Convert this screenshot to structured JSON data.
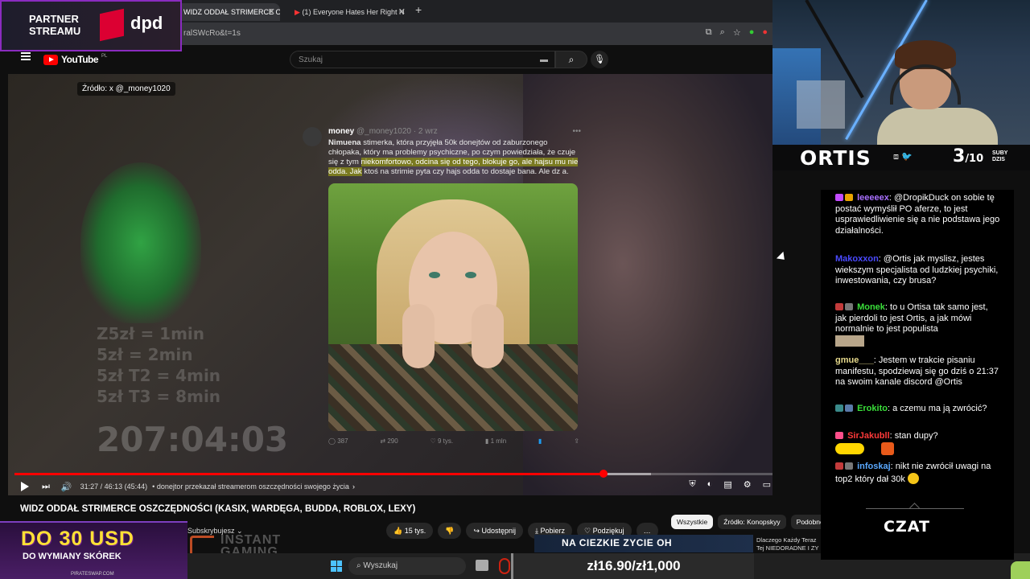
{
  "browser": {
    "tabs": [
      {
        "label": "WIDZ ODDAŁ STRIMERCE O",
        "active": true
      },
      {
        "label": "(1) Everyone Hates Her Right N",
        "active": false
      }
    ],
    "url": "ralSWcRo&t=1s"
  },
  "youtube": {
    "logo_text": "YouTube",
    "region": "PL",
    "search_placeholder": "Szukaj"
  },
  "video": {
    "source_tag": "Źródło: x @_money1020",
    "overlay_lines": [
      "Z5zł = 1min",
      "5zł = 2min",
      "5zł T2 = 4min",
      "5zł T3 = 8min"
    ],
    "overlay_timer": "207:04:03",
    "tweet": {
      "author": "money",
      "handle": "@_money1020 · 2 wrz",
      "text_lead": "Nimuena",
      "text_main": " stimerka, która przyjęła 50k donejtów od zaburzonego chłopaka, który ma problemy psychiczne, po czym powiedziała, że czuje się z tym ",
      "text_highlight": "niekomfortowo, odcina się od tego, blokuje go, ale hajsu mu nie odda. Jak",
      "text_tail": " ktoś na strimie pyta czy hajs odda to dostaje bana. Ale dz      a.",
      "stats": {
        "replies": "387",
        "reposts": "290",
        "likes": "9 tys.",
        "views": "1 mln"
      }
    },
    "progress": {
      "played": 0.777,
      "buffered_end": 0.84
    },
    "time": "31:27 / 46:13 (45:44)",
    "chapter": "• donejtor przekazał streamerom oszczędności swojego życia"
  },
  "below": {
    "title": "WIDZ ODDAŁ STRIMERCE OSZCZĘDNOŚCI (KASIX, WARDĘGA, BUDDA, ROBLOX, LEXY)",
    "subscribed": "Subskrybujesz",
    "likes": "15 tys.",
    "share": "Udostępnij",
    "download": "Pobierz",
    "thanks": "Podziękuj",
    "more": "…",
    "chips": [
      {
        "label": "Wszystkie",
        "active": true
      },
      {
        "label": "Źródło: Konopskyy",
        "active": false
      },
      {
        "label": "Podobne",
        "active": false
      }
    ],
    "suggestion": "Dlaczego Każdy Teraz Tej NIEDORADNE I ZY"
  },
  "overlays": {
    "partner_text": [
      "PARTNER",
      "STREAMU"
    ],
    "partner_brand": "dpd",
    "skin_ad_big": "DO 30 USD",
    "skin_ad_small": "DO WYMIANY SKÓREK",
    "skin_ad_url": "PIRATESWAP.COM",
    "instant_lines": [
      "INSTANT",
      "GAMING"
    ],
    "train_banner": "NA CIEZKIE ZYCIE OH",
    "price": "zł16.90/zł1,000"
  },
  "taskbar": {
    "search": "Wyszukaj"
  },
  "streamer": {
    "name": "ORTIS",
    "subs_current": "3",
    "subs_target": "/10",
    "subs_label": [
      "SUBY",
      "DZIS"
    ]
  },
  "chat": {
    "label": "CZAT",
    "messages": [
      {
        "user": "leeeeex",
        "color": "#a970ff",
        "badge_colors": [
          "#c24bff",
          "#e8a300"
        ],
        "text": ": @DropikDuck on sobie tę postać wymyślił PO aferze, to jest usprawiedliwienie się a nie podstawa jego działalności."
      },
      {
        "user": "Makoxxon",
        "color": "#4a4aff",
        "badge_colors": [],
        "text": ": @Ortis jak myslisz, jestes wiekszym specjalista od ludzkiej psychiki, inwestowania, czy brusa?"
      },
      {
        "user": "Monek",
        "color": "#3adf3a",
        "badge_colors": [
          "#c23b3b",
          "#777"
        ],
        "text": ": to u Ortisa tak samo jest, jak pierdoli to jest Ortis, a jak mówi normalnie to jest populista"
      },
      {
        "user": "gmue___",
        "color": "#e6d98c",
        "badge_colors": [],
        "text": ": Jestem w trakcie pisaniu manifestu, spodziewaj się go dziś o 21:37 na swoim kanale discord @Ortis"
      },
      {
        "user": "Erokito",
        "color": "#3adf3a",
        "badge_colors": [
          "#3a8a8a",
          "#5a7aaa"
        ],
        "text": ": a czemu ma ją zwrócić?"
      },
      {
        "user": "SirJakubll",
        "color": "#ff3a3a",
        "badge_colors": [
          "#ff4f8b"
        ],
        "text": ": stan dupy?"
      },
      {
        "user": "infoskaj",
        "color": "#5aa9ff",
        "badge_colors": [
          "#c23b3b",
          "#777"
        ],
        "text": ": nikt nie zwrócił uwagi na top2 który dał 30k"
      }
    ]
  }
}
